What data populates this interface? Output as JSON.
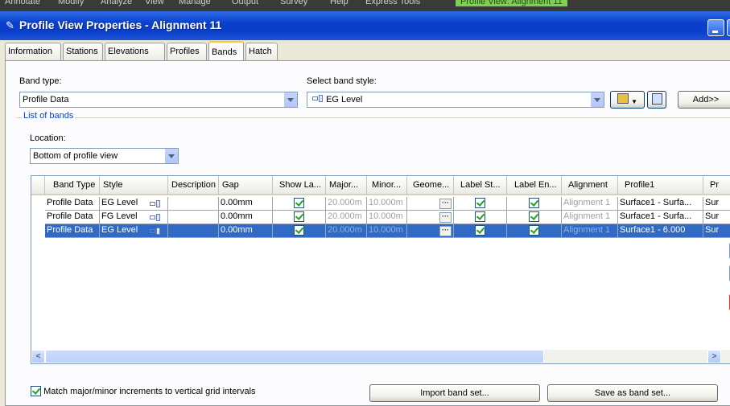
{
  "ribbon": {
    "items": [
      "Annotate",
      "Modify",
      "Analyze",
      "View",
      "Manage",
      "Output",
      "Survey",
      "Help",
      "Express Tools",
      "Profile View: Alignment 11"
    ]
  },
  "window": {
    "title": "Profile View Properties - Alignment 11"
  },
  "tabs": [
    "Information",
    "Stations",
    "Elevations",
    "Profiles",
    "Bands",
    "Hatch"
  ],
  "active_tab": "Bands",
  "band_type": {
    "label": "Band type:",
    "value": "Profile Data"
  },
  "band_style": {
    "label": "Select band style:",
    "value": "EG Level"
  },
  "buttons": {
    "add": "Add>>",
    "import": "Import band set...",
    "save": "Save as band set..."
  },
  "list": {
    "legend": "List of bands",
    "location_label": "Location:",
    "location_value": "Bottom of profile view"
  },
  "columns": [
    "Band Type",
    "Style",
    "Description",
    "Gap",
    "Show La...",
    "Major...",
    "Minor...",
    "Geome...",
    "Label St...",
    "Label En...",
    "Alignment",
    "Profile1",
    "Pr"
  ],
  "rows": [
    {
      "type": "Profile Data",
      "style": "EG Level",
      "gap": "0.00mm",
      "major": "20.000m",
      "minor": "10.000m",
      "alignment": "Alignment 1",
      "profile1": "Surface1 - Surfa...",
      "pr": "Sur",
      "selected": false
    },
    {
      "type": "Profile Data",
      "style": "FG Level",
      "gap": "0.00mm",
      "major": "20.000m",
      "minor": "10.000m",
      "alignment": "Alignment 1",
      "profile1": "Surface1 - Surfa...",
      "pr": "Sur",
      "selected": false
    },
    {
      "type": "Profile Data",
      "style": "EG Level",
      "gap": "0.00mm",
      "major": "20.000m",
      "minor": "10.000m",
      "alignment": "Alignment 1",
      "profile1": "Surface1 - 6.000",
      "pr": "Sur",
      "selected": true
    }
  ],
  "match": {
    "label": "Match major/minor increments to vertical grid intervals"
  },
  "colors": {
    "title_bar": "#0a3fcc",
    "selection": "#316ac5",
    "active_tab_accent": "#ffc83c"
  }
}
